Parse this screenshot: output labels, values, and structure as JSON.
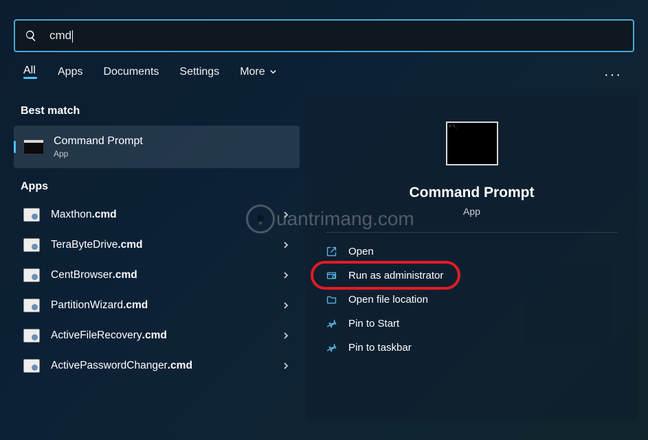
{
  "search": {
    "query": "cmd"
  },
  "tabs": {
    "items": [
      "All",
      "Apps",
      "Documents",
      "Settings"
    ],
    "more": "More",
    "active_index": 0
  },
  "sections": {
    "best_match": "Best match",
    "apps": "Apps"
  },
  "best_match": {
    "title": "Command Prompt",
    "subtitle": "App"
  },
  "app_results": [
    {
      "prefix": "Maxthon",
      "bold": ".cmd"
    },
    {
      "prefix": "TeraByteDrive",
      "bold": ".cmd"
    },
    {
      "prefix": "CentBrowser",
      "bold": ".cmd"
    },
    {
      "prefix": "PartitionWizard",
      "bold": ".cmd"
    },
    {
      "prefix": "ActiveFileRecovery",
      "bold": ".cmd"
    },
    {
      "prefix": "ActivePasswordChanger",
      "bold": ".cmd"
    }
  ],
  "preview": {
    "title": "Command Prompt",
    "subtitle": "App",
    "actions": {
      "open": "Open",
      "run_admin": "Run as administrator",
      "open_location": "Open file location",
      "pin_start": "Pin to Start",
      "pin_taskbar": "Pin to taskbar"
    }
  },
  "watermark": "uantrimang.com",
  "colors": {
    "accent": "#4cc2ff",
    "highlight_ring": "#e31b23"
  }
}
